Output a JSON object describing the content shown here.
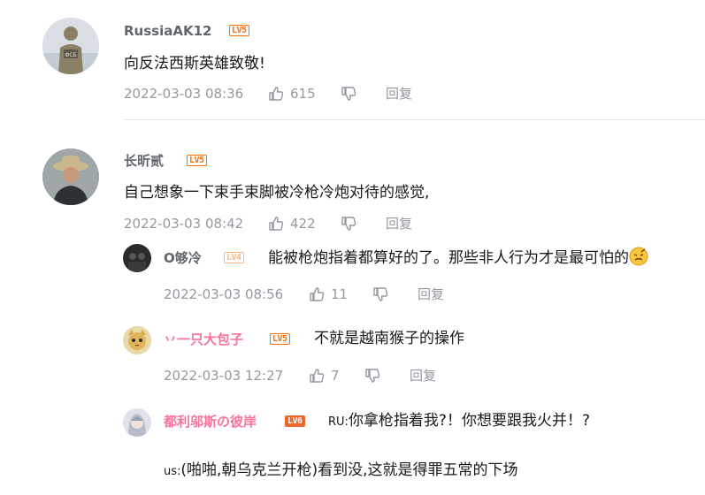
{
  "comments": [
    {
      "username": "RussiaAK12",
      "level": "LV5",
      "text": "向反法西斯英雄致敬!",
      "time": "2022-03-03 08:36",
      "likes": "615",
      "reply_label": "回复",
      "avatar_badge": "ФСБ"
    },
    {
      "username": "长昕贰",
      "level": "LV5",
      "text": "自己想象一下束手束脚被冷枪冷炮对待的感觉,",
      "time": "2022-03-03 08:42",
      "likes": "422",
      "reply_label": "回复",
      "replies": [
        {
          "username": "O够冷",
          "level": "LV4",
          "text": "能被枪炮指着都算好的了。那些非人行为才是最可怕的",
          "time": "2022-03-03 08:56",
          "likes": "11",
          "reply_label": "回复"
        },
        {
          "username": "丷一只大包子",
          "level": "LV5",
          "text": "不就是越南猴子的操作",
          "time": "2022-03-03 12:27",
          "likes": "7",
          "reply_label": "回复"
        },
        {
          "username": "都利邬斯の彼岸",
          "level": "LV6",
          "prefix1": "RU:",
          "text1": "你拿枪指着我?！你想要跟我火并！?",
          "prefix2": "us:",
          "text2": "(啪啪,朝乌克兰开枪)看到没,这就是得罪五常的下场"
        }
      ]
    }
  ],
  "icons": [
    "thumb-up-icon",
    "thumb-down-icon",
    "emoji-icon"
  ],
  "colors": {
    "level5": "#ff6c00",
    "level4": "#ffb37c",
    "level6": "#ee672a",
    "vip_name": "#fb7299",
    "meta": "#9499a0"
  }
}
